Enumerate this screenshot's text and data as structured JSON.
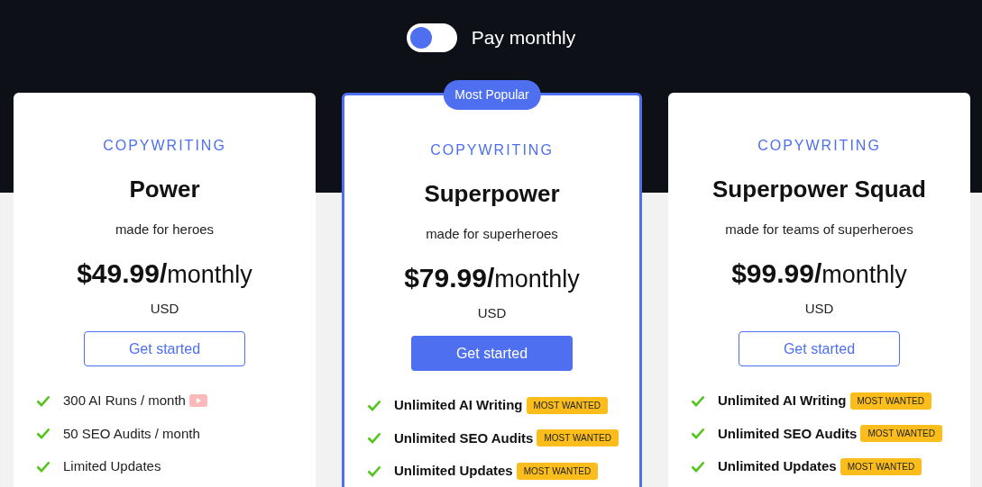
{
  "billing_toggle": {
    "on": false,
    "label": "Pay monthly"
  },
  "plans": [
    {
      "featured": false,
      "category": "COPYWRITING",
      "name": "Power",
      "tagline": "made for heroes",
      "price": "$49.99/",
      "period": "monthly",
      "currency": "USD",
      "button": "Get started",
      "features": [
        {
          "text": "300 AI Runs / month",
          "highlighted": false,
          "video": true
        },
        {
          "text": "50 SEO Audits / month",
          "highlighted": false
        },
        {
          "text": "Limited Updates",
          "highlighted": false
        }
      ]
    },
    {
      "featured": true,
      "badge": "Most Popular",
      "category": "COPYWRITING",
      "name": "Superpower",
      "tagline": "made for superheroes",
      "price": "$79.99/",
      "period": "monthly",
      "currency": "USD",
      "button": "Get started",
      "features": [
        {
          "text": "Unlimited AI Writing",
          "highlighted": true,
          "tag": "MOST WANTED"
        },
        {
          "text": "Unlimited SEO Audits",
          "highlighted": true,
          "tag": "MOST WANTED"
        },
        {
          "text": "Unlimited Updates",
          "highlighted": true,
          "tag": "MOST WANTED"
        }
      ]
    },
    {
      "featured": false,
      "category": "COPYWRITING",
      "name": "Superpower Squad",
      "tagline": "made for teams of superheroes",
      "price": "$99.99/",
      "period": "monthly",
      "currency": "USD",
      "button": "Get started",
      "features": [
        {
          "text": "Unlimited AI Writing",
          "highlighted": true,
          "tag": "MOST WANTED"
        },
        {
          "text": "Unlimited SEO Audits",
          "highlighted": true,
          "tag": "MOST WANTED"
        },
        {
          "text": "Unlimited Updates",
          "highlighted": true,
          "tag": "MOST WANTED"
        }
      ]
    }
  ]
}
